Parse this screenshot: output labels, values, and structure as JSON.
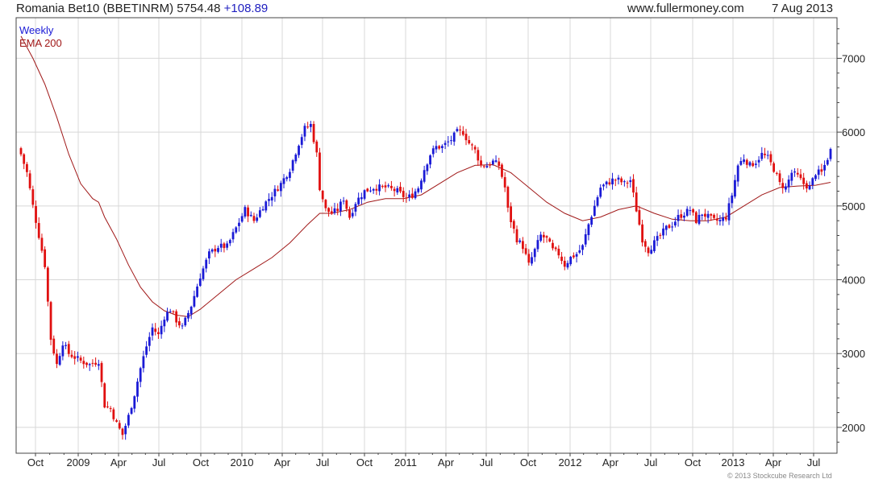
{
  "header": {
    "title": "Romania Bet10 (BBETINRM) 5754.48",
    "change": "+108.89",
    "site": "www.fullermoney.com",
    "date": "7 Aug 2013"
  },
  "footer": {
    "copyright": "© 2013 Stockcube Research Ltd"
  },
  "colors": {
    "up": "#1a1ad6",
    "down": "#e01010",
    "ema": "#a01818",
    "grid": "#d8d8d8",
    "axis": "#444444"
  },
  "chart_data": {
    "type": "candlestick",
    "legend": [
      {
        "label": "Weekly",
        "color": "#1a1ad6"
      },
      {
        "label": "EMA 200",
        "color": "#a01818"
      }
    ],
    "y_ticks": [
      2000,
      3000,
      4000,
      5000,
      6000,
      7000
    ],
    "ylim": [
      1650,
      7550
    ],
    "x_ticks": [
      "Oct",
      "2009",
      "Apr",
      "Jul",
      "Oct",
      "2010",
      "Apr",
      "Jul",
      "Oct",
      "2011",
      "Apr",
      "Jul",
      "Oct",
      "2012",
      "Apr",
      "Jul",
      "Oct",
      "2013",
      "Apr",
      "Jul"
    ],
    "close_path": [
      [
        0,
        5700
      ],
      [
        2,
        5450
      ],
      [
        4,
        5000
      ],
      [
        6,
        4600
      ],
      [
        8,
        4200
      ],
      [
        10,
        3200
      ],
      [
        12,
        2850
      ],
      [
        14,
        3150
      ],
      [
        16,
        3000
      ],
      [
        18,
        2950
      ],
      [
        20,
        2900
      ],
      [
        23,
        2850
      ],
      [
        26,
        2900
      ],
      [
        28,
        2300
      ],
      [
        30,
        2250
      ],
      [
        32,
        2050
      ],
      [
        34,
        1900
      ],
      [
        36,
        2150
      ],
      [
        38,
        2450
      ],
      [
        40,
        2800
      ],
      [
        42,
        3100
      ],
      [
        44,
        3350
      ],
      [
        46,
        3250
      ],
      [
        48,
        3500
      ],
      [
        50,
        3600
      ],
      [
        52,
        3450
      ],
      [
        54,
        3350
      ],
      [
        57,
        3650
      ],
      [
        60,
        4050
      ],
      [
        63,
        4350
      ],
      [
        66,
        4450
      ],
      [
        69,
        4450
      ],
      [
        72,
        4700
      ],
      [
        75,
        4950
      ],
      [
        78,
        4800
      ],
      [
        81,
        5000
      ],
      [
        84,
        5150
      ],
      [
        87,
        5300
      ],
      [
        90,
        5500
      ],
      [
        93,
        5850
      ],
      [
        95,
        6050
      ],
      [
        97,
        6100
      ],
      [
        99,
        5700
      ],
      [
        100,
        5250
      ],
      [
        102,
        4950
      ],
      [
        104,
        4900
      ],
      [
        106,
        4950
      ],
      [
        108,
        5100
      ],
      [
        110,
        4850
      ],
      [
        112,
        5050
      ],
      [
        115,
        5200
      ],
      [
        118,
        5250
      ],
      [
        122,
        5250
      ],
      [
        126,
        5200
      ],
      [
        129,
        5100
      ],
      [
        131,
        5150
      ],
      [
        133,
        5250
      ],
      [
        135,
        5500
      ],
      [
        137,
        5700
      ],
      [
        139,
        5800
      ],
      [
        141,
        5800
      ],
      [
        144,
        5900
      ],
      [
        146,
        6000
      ],
      [
        148,
        6000
      ],
      [
        150,
        5850
      ],
      [
        152,
        5750
      ],
      [
        154,
        5550
      ],
      [
        156,
        5550
      ],
      [
        158,
        5600
      ],
      [
        160,
        5550
      ],
      [
        162,
        5250
      ],
      [
        163,
        4950
      ],
      [
        164,
        4800
      ],
      [
        166,
        4550
      ],
      [
        168,
        4450
      ],
      [
        170,
        4200
      ],
      [
        172,
        4400
      ],
      [
        174,
        4600
      ],
      [
        176,
        4550
      ],
      [
        178,
        4400
      ],
      [
        180,
        4350
      ],
      [
        182,
        4200
      ],
      [
        184,
        4300
      ],
      [
        186,
        4350
      ],
      [
        188,
        4450
      ],
      [
        190,
        4750
      ],
      [
        192,
        5000
      ],
      [
        194,
        5250
      ],
      [
        196,
        5300
      ],
      [
        198,
        5350
      ],
      [
        200,
        5350
      ],
      [
        202,
        5300
      ],
      [
        204,
        5350
      ],
      [
        206,
        4950
      ],
      [
        208,
        4550
      ],
      [
        210,
        4400
      ],
      [
        212,
        4500
      ],
      [
        214,
        4600
      ],
      [
        216,
        4700
      ],
      [
        218,
        4750
      ],
      [
        220,
        4850
      ],
      [
        222,
        4900
      ],
      [
        224,
        4950
      ],
      [
        226,
        4800
      ],
      [
        228,
        4900
      ],
      [
        230,
        4850
      ],
      [
        232,
        4800
      ],
      [
        234,
        4800
      ],
      [
        236,
        4850
      ],
      [
        238,
        5150
      ],
      [
        240,
        5550
      ],
      [
        242,
        5650
      ],
      [
        244,
        5550
      ],
      [
        246,
        5600
      ],
      [
        248,
        5700
      ],
      [
        250,
        5650
      ],
      [
        252,
        5500
      ],
      [
        254,
        5300
      ],
      [
        256,
        5250
      ],
      [
        258,
        5450
      ],
      [
        260,
        5400
      ],
      [
        262,
        5300
      ],
      [
        264,
        5250
      ],
      [
        266,
        5450
      ],
      [
        268,
        5450
      ],
      [
        270,
        5650
      ],
      [
        271,
        5754
      ]
    ],
    "ema_200": [
      [
        0,
        7300
      ],
      [
        4,
        7000
      ],
      [
        8,
        6650
      ],
      [
        12,
        6200
      ],
      [
        16,
        5700
      ],
      [
        20,
        5300
      ],
      [
        24,
        5100
      ],
      [
        26,
        5050
      ],
      [
        28,
        4850
      ],
      [
        32,
        4550
      ],
      [
        36,
        4200
      ],
      [
        40,
        3900
      ],
      [
        44,
        3700
      ],
      [
        48,
        3580
      ],
      [
        52,
        3520
      ],
      [
        56,
        3500
      ],
      [
        60,
        3600
      ],
      [
        66,
        3800
      ],
      [
        72,
        4000
      ],
      [
        78,
        4150
      ],
      [
        84,
        4300
      ],
      [
        90,
        4500
      ],
      [
        96,
        4750
      ],
      [
        100,
        4900
      ],
      [
        104,
        4900
      ],
      [
        110,
        4950
      ],
      [
        116,
        5050
      ],
      [
        122,
        5100
      ],
      [
        128,
        5100
      ],
      [
        134,
        5150
      ],
      [
        140,
        5300
      ],
      [
        146,
        5450
      ],
      [
        152,
        5550
      ],
      [
        158,
        5560
      ],
      [
        164,
        5450
      ],
      [
        170,
        5250
      ],
      [
        176,
        5050
      ],
      [
        182,
        4900
      ],
      [
        188,
        4800
      ],
      [
        194,
        4850
      ],
      [
        200,
        4950
      ],
      [
        206,
        5000
      ],
      [
        212,
        4900
      ],
      [
        218,
        4820
      ],
      [
        224,
        4800
      ],
      [
        230,
        4800
      ],
      [
        236,
        4850
      ],
      [
        242,
        5000
      ],
      [
        248,
        5150
      ],
      [
        254,
        5250
      ],
      [
        260,
        5270
      ],
      [
        266,
        5280
      ],
      [
        271,
        5320
      ]
    ]
  }
}
